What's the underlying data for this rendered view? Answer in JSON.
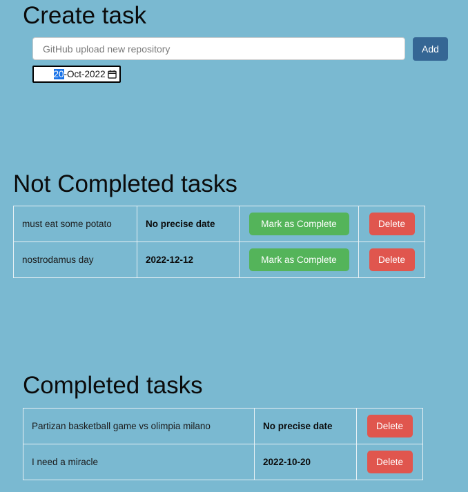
{
  "create": {
    "heading": "Create task",
    "title_input": {
      "value": "",
      "placeholder": "GitHub upload new repository"
    },
    "add_label": "Add",
    "date_input": {
      "value": "20-Oct-2022",
      "selected_segment": "20",
      "rest": "-Oct-2022",
      "picker_icon": "calendar-icon"
    }
  },
  "not_completed": {
    "heading": "Not Completed tasks",
    "rows": [
      {
        "title": "must eat some potato",
        "date": "No precise date",
        "complete_label": "Mark as Complete",
        "delete_label": "Delete"
      },
      {
        "title": "nostrodamus day",
        "date": "2022-12-12",
        "complete_label": "Mark as Complete",
        "delete_label": "Delete"
      }
    ]
  },
  "completed": {
    "heading": "Completed tasks",
    "rows": [
      {
        "title": "Partizan basketball game vs olimpia milano",
        "date": "No precise date",
        "delete_label": "Delete"
      },
      {
        "title": "I need a miracle",
        "date": "2022-10-20",
        "delete_label": "Delete"
      }
    ]
  },
  "colors": {
    "page_background": "#7ab9d1",
    "add_button": "#356694",
    "complete_button": "#54b45a",
    "delete_button": "#e0564e",
    "table_border": "#e8f1f5",
    "date_selection": "#1a73e8"
  }
}
